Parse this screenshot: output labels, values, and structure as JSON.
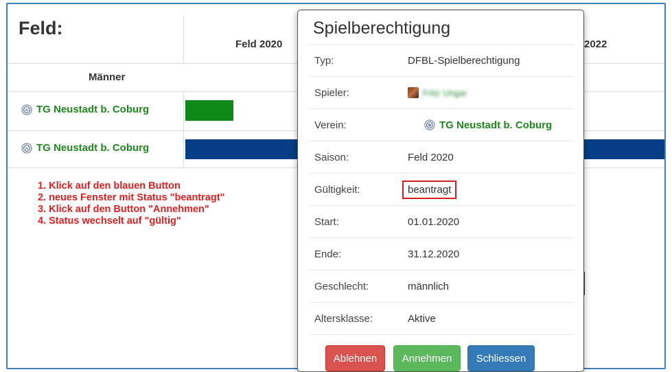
{
  "table": {
    "title": "Feld:",
    "seasons": [
      "Feld 2020",
      "2022"
    ],
    "gender_header": "Männer",
    "rows": [
      {
        "club": "TG Neustadt b. Coburg",
        "bar_color": "#0f8a1a"
      },
      {
        "club": "TG Neustadt b. Coburg",
        "bar_color": "#063f86"
      }
    ]
  },
  "instructions": [
    "1. Klick auf den blauen Button",
    "2. neues Fenster mit Status \"beantragt\"",
    "3. Klick auf den Button \"Annehmen\"",
    "4. Status wechselt auf \"gültig\""
  ],
  "modal": {
    "title": "Spielberechtigung",
    "fields": [
      {
        "label": "Typ:",
        "value": "DFBL-Spielberechtigung"
      },
      {
        "label": "Spieler:",
        "value": "Fritz Ungar"
      },
      {
        "label": "Verein:",
        "value": "TG Neustadt b. Coburg"
      },
      {
        "label": "Saison:",
        "value": "Feld 2020"
      },
      {
        "label": "Gültigkeit:",
        "value": "beantragt"
      },
      {
        "label": "Start:",
        "value": "01.01.2020"
      },
      {
        "label": "Ende:",
        "value": "31.12.2020"
      },
      {
        "label": "Geschlecht:",
        "value": "männlich"
      },
      {
        "label": "Altersklasse:",
        "value": "Aktive"
      }
    ],
    "buttons": {
      "reject": "Ablehnen",
      "accept": "Annehmen",
      "close": "Schliessen"
    }
  },
  "colors": {
    "frame": "#3d7fbf",
    "club_text": "#1e8a1e",
    "instruction_text": "#e02020",
    "highlight_border": "#d62020"
  },
  "icons": {
    "club": "club-crest-icon",
    "player": "avatar-icon"
  }
}
